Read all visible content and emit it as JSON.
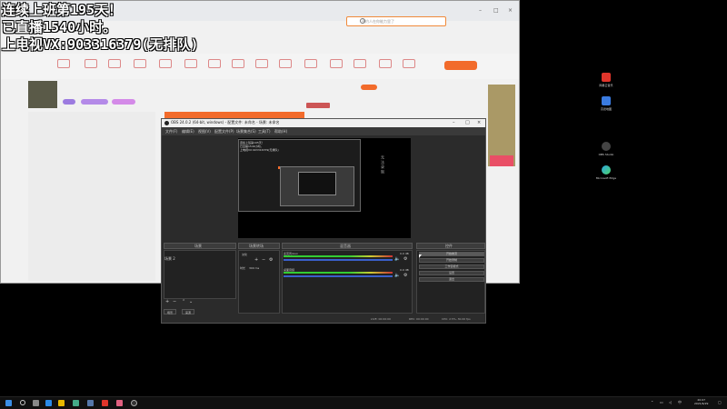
{
  "overlay": {
    "line1": "连续上班第195天！",
    "line2": "已直播1540小时。",
    "line3": "上电视VX:903316379(无排队)"
  },
  "browser": {
    "search_placeholder": "预约人在你能力里了"
  },
  "obs": {
    "title": "OBS 24.0.2 (64-bit, windows) - 配置文件: 未命名 - 场景: 未命名",
    "menu": [
      "文件(F)",
      "编辑(E)",
      "视图(V)",
      "配置文件(P)",
      "场景集合(S)",
      "工具(T)",
      "帮助(H)"
    ],
    "nested_text": [
      "连续上班第195天！",
      "已直播1540小时。",
      "上电视VX:903316379(无排队)"
    ],
    "vertical_chars": "无 法 录 制",
    "docks": {
      "scenes": "场景",
      "sources": "来源",
      "mixer": "混音器",
      "transitions": "场景转场",
      "controls": "控件"
    },
    "scene_item": "场景 2",
    "transition_value": "淡化",
    "duration_label": "时长",
    "duration_value": "300 ms",
    "mixer_items": [
      {
        "name": "麦克风/Aux",
        "level": "0.0 dB"
      },
      {
        "name": "桌面音频",
        "level": "0.0 dB"
      }
    ],
    "controls": [
      "开始推流",
      "开始录制",
      "工作室模式",
      "设置",
      "退出"
    ],
    "tabs": [
      "场景",
      "来源"
    ],
    "status": {
      "live": "LIVE: 00:00:00",
      "rec": "REC: 00:00:00",
      "cpu": "CPU: 2.5%, 30.00 fps"
    }
  },
  "desktop_icons": [
    {
      "label": "网易云音乐"
    },
    {
      "label": "高德地图"
    },
    {
      "label": "OBS Studio"
    },
    {
      "label": "Microsoft Edge"
    }
  ],
  "clock": {
    "time": "20:07",
    "date": "2021/6/29"
  },
  "colors": {
    "accent": "#f26b2b",
    "obs_bg": "#2b2b2b"
  }
}
